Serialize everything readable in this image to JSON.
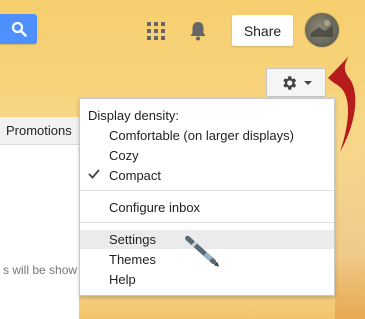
{
  "header": {
    "share_label": "Share",
    "icons": [
      "search-icon",
      "apps-grid-icon",
      "notifications-bell-icon",
      "gear-icon"
    ]
  },
  "tabs": {
    "promotions_label": "Promotions"
  },
  "main": {
    "empty_message": "s will be show"
  },
  "menu": {
    "display_density_label": "Display density:",
    "density_options": [
      {
        "label": "Comfortable (on larger displays)",
        "selected": false
      },
      {
        "label": "Cozy",
        "selected": false
      },
      {
        "label": "Compact",
        "selected": true
      }
    ],
    "configure_inbox_label": "Configure inbox",
    "settings_label": "Settings",
    "themes_label": "Themes",
    "help_label": "Help"
  },
  "colors": {
    "accent_blue": "#4d90fe",
    "annotation_arrow": "#b71c1c",
    "background": "#f7d27a"
  }
}
